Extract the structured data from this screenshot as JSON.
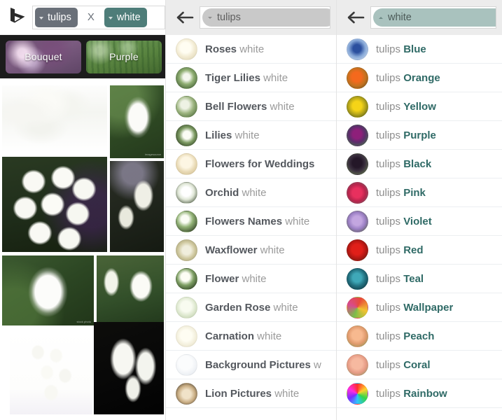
{
  "left_panel": {
    "logo": "bing-logo",
    "search_tokens": [
      {
        "label": "tulips",
        "style": "gray"
      },
      {
        "label": "white",
        "style": "teal"
      }
    ],
    "clear_label": "X",
    "chips": [
      {
        "label": "Bouquet",
        "thumb": "bg-bouquet"
      },
      {
        "label": "Purple",
        "thumb": "bg-purple"
      }
    ],
    "images": [
      {
        "name": "white-tulip-bouquet",
        "thumb": "t-bouquet-lt",
        "watermark": ""
      },
      {
        "name": "single-white-tulip-green",
        "thumb": "t-single-green",
        "watermark": "imagesource"
      },
      {
        "name": "white-tulip-field",
        "thumb": "t-field-white",
        "watermark": ""
      },
      {
        "name": "white-tulips-dark",
        "thumb": "t-dark-cluster",
        "watermark": ""
      },
      {
        "name": "white-tulip-macro",
        "thumb": "t-macro-tulip",
        "watermark": "stock photo"
      },
      {
        "name": "white-tulip-pair",
        "thumb": "t-pair-white",
        "watermark": ""
      },
      {
        "name": "white-tulip-vase",
        "thumb": "t-vase-bunch",
        "watermark": ""
      },
      {
        "name": "white-tulips-black-bg",
        "thumb": "t-black-bg",
        "watermark": ""
      }
    ]
  },
  "mid_panel": {
    "back_icon": "back-arrow-icon",
    "query_pill": "tulips",
    "query_pill_style": "gray",
    "suggestions": [
      {
        "lead": "",
        "strong": "Roses",
        "weak": "white",
        "thumb": "c-rose-white"
      },
      {
        "lead": "",
        "strong": "Tiger Lilies",
        "weak": "white",
        "thumb": "c-tiger-lily"
      },
      {
        "lead": "",
        "strong": "Bell Flowers",
        "weak": "white",
        "thumb": "c-bell-flower"
      },
      {
        "lead": "",
        "strong": "Lilies",
        "weak": "white",
        "thumb": "c-lilies"
      },
      {
        "lead": "",
        "strong": "Flowers for Weddings",
        "weak": "",
        "thumb": "c-wedding"
      },
      {
        "lead": "",
        "strong": "Orchid",
        "weak": "white",
        "thumb": "c-orchid"
      },
      {
        "lead": "",
        "strong": "Flowers Names",
        "weak": "white",
        "thumb": "c-flw-names"
      },
      {
        "lead": "",
        "strong": "Waxflower",
        "weak": "white",
        "thumb": "c-waxflower"
      },
      {
        "lead": "",
        "strong": "Flower",
        "weak": "white",
        "thumb": "c-flower"
      },
      {
        "lead": "",
        "strong": "Garden Rose",
        "weak": "white",
        "thumb": "c-garden-rose"
      },
      {
        "lead": "",
        "strong": "Carnation",
        "weak": "white",
        "thumb": "c-carnation"
      },
      {
        "lead": "",
        "strong": "Background Pictures",
        "weak": "w",
        "thumb": "c-background"
      },
      {
        "lead": "",
        "strong": "Lion Pictures",
        "weak": "white",
        "thumb": "c-lion"
      }
    ]
  },
  "right_panel": {
    "back_icon": "back-arrow-icon",
    "query_pill": "white",
    "query_pill_style": "sage",
    "suggestions": [
      {
        "lead": "tulips",
        "accent": "Blue",
        "thumb": "c-blue"
      },
      {
        "lead": "tulips",
        "accent": "Orange",
        "thumb": "c-orange"
      },
      {
        "lead": "tulips",
        "accent": "Yellow",
        "thumb": "c-yellow"
      },
      {
        "lead": "tulips",
        "accent": "Purple",
        "thumb": "c-purplet"
      },
      {
        "lead": "tulips",
        "accent": "Black",
        "thumb": "c-black"
      },
      {
        "lead": "tulips",
        "accent": "Pink",
        "thumb": "c-pink"
      },
      {
        "lead": "tulips",
        "accent": "Violet",
        "thumb": "c-violet"
      },
      {
        "lead": "tulips",
        "accent": "Red",
        "thumb": "c-red"
      },
      {
        "lead": "tulips",
        "accent": "Teal",
        "thumb": "c-teal"
      },
      {
        "lead": "tulips",
        "accent": "Wallpaper",
        "thumb": "c-wall"
      },
      {
        "lead": "tulips",
        "accent": "Peach",
        "thumb": "c-peach"
      },
      {
        "lead": "tulips",
        "accent": "Coral",
        "thumb": "c-coral"
      },
      {
        "lead": "tulips",
        "accent": "Rainbow",
        "thumb": "c-rainbow"
      }
    ]
  },
  "colors": {
    "token_gray": "#6a7079",
    "token_teal": "#4e7d79",
    "accent_teal": "#2f6a66",
    "pill_sage": "#a9c2be",
    "pill_gray": "#c9c9c9",
    "header_bg": "#ececec",
    "chips_bar": "#1c1c1c"
  }
}
